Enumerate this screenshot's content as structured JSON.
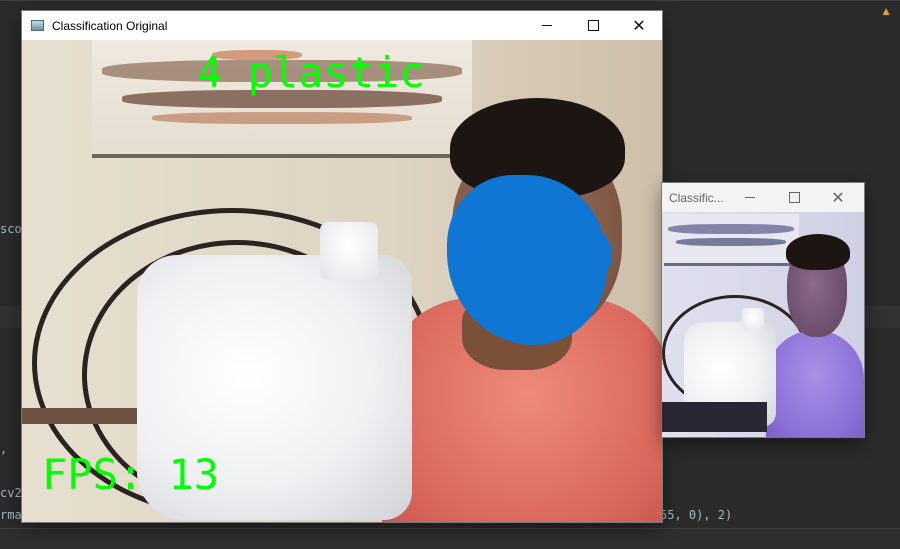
{
  "ide": {
    "fragments": [
      "sco",
      ", ",
      "cv2",
      "rmat",
      "55, 0), 2)"
    ],
    "warning_icon": "warning-triangle-icon"
  },
  "main_window": {
    "title": "Classification Original",
    "controls": [
      "minimize",
      "maximize",
      "close"
    ],
    "overlay": {
      "label_text": "4 plastic",
      "fps_text": "FPS: 13",
      "color": "#00ff00"
    }
  },
  "small_window": {
    "title": "Classific...",
    "controls": [
      "minimize",
      "maximize",
      "close"
    ]
  },
  "colors": {
    "overlay_green": "#00ff00",
    "redaction_blue": "#0f76d4",
    "ide_background": "#2b2b2b"
  }
}
